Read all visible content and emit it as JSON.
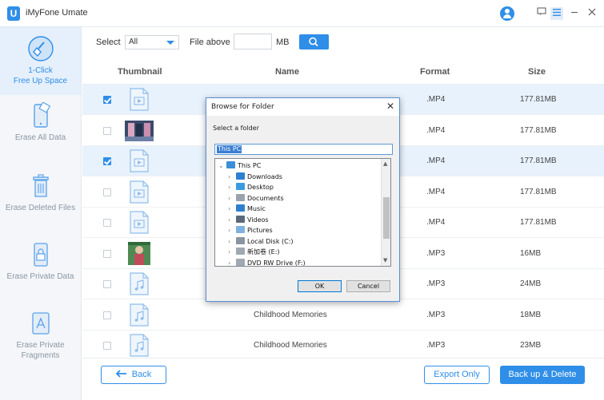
{
  "app": {
    "title": "iMyFone Umate",
    "logo_letter": "U"
  },
  "sidebar": {
    "items": [
      {
        "label": "1-Click\nFree Up Space",
        "line1": "1-Click",
        "line2": "Free Up Space",
        "icon": "broom-icon",
        "active": true
      },
      {
        "label": "Erase All Data",
        "icon": "phone-eraser-icon",
        "active": false
      },
      {
        "label": "Erase Deleted Files",
        "icon": "trash-icon",
        "active": false
      },
      {
        "label": "Erase Private Data",
        "icon": "lock-icon",
        "active": false
      },
      {
        "label": "Erase Private Fragments",
        "line1": "Erase Private",
        "line2": "Fragments",
        "icon": "app-fragment-icon",
        "active": false
      }
    ]
  },
  "filter": {
    "select_label": "Select",
    "select_value": "All",
    "file_above_label": "File above",
    "size_value": "",
    "unit": "MB"
  },
  "table": {
    "headers": {
      "thumbnail": "Thumbnail",
      "name": "Name",
      "format": "Format",
      "size": "Size"
    },
    "rows": [
      {
        "checked": true,
        "thumb": "video",
        "name": "",
        "format": ".MP4",
        "size": "177.81MB"
      },
      {
        "checked": false,
        "thumb": "photo",
        "name": "",
        "format": ".MP4",
        "size": "177.81MB"
      },
      {
        "checked": true,
        "thumb": "video",
        "name": "",
        "format": ".MP4",
        "size": "177.81MB"
      },
      {
        "checked": false,
        "thumb": "video",
        "name": "",
        "format": ".MP4",
        "size": "177.81MB"
      },
      {
        "checked": false,
        "thumb": "video",
        "name": "",
        "format": ".MP4",
        "size": "177.81MB"
      },
      {
        "checked": false,
        "thumb": "photo2",
        "name": "",
        "format": ".MP3",
        "size": "16MB"
      },
      {
        "checked": false,
        "thumb": "audio",
        "name": "",
        "format": ".MP3",
        "size": "24MB"
      },
      {
        "checked": false,
        "thumb": "audio",
        "name": "Childhood Memories",
        "format": ".MP3",
        "size": "18MB"
      },
      {
        "checked": false,
        "thumb": "audio",
        "name": "Childhood Memories",
        "format": ".MP3",
        "size": "23MB"
      }
    ]
  },
  "footer": {
    "back": "Back",
    "export": "Export Only",
    "delete": "Back up & Delete"
  },
  "dialog": {
    "title": "Browse for Folder",
    "subtitle": "Select a folder",
    "input_value": "This PC",
    "tree": [
      {
        "label": "This PC",
        "level": 0,
        "expanded": true,
        "icon": "monitor-icon"
      },
      {
        "label": "Downloads",
        "level": 1,
        "icon": "download-icon"
      },
      {
        "label": "Desktop",
        "level": 1,
        "icon": "desktop-icon"
      },
      {
        "label": "Documents",
        "level": 1,
        "icon": "documents-icon"
      },
      {
        "label": "Music",
        "level": 1,
        "icon": "music-icon"
      },
      {
        "label": "Videos",
        "level": 1,
        "icon": "videos-icon"
      },
      {
        "label": "Pictures",
        "level": 1,
        "icon": "pictures-icon"
      },
      {
        "label": "Local Disk (C:)",
        "level": 1,
        "icon": "disk-icon"
      },
      {
        "label": "新加卷 (E:)",
        "level": 1,
        "icon": "drive-icon"
      },
      {
        "label": "DVD RW Drive (F:)",
        "level": 1,
        "icon": "dvd-icon"
      }
    ],
    "ok": "OK",
    "cancel": "Cancel"
  },
  "colors": {
    "accent": "#2f8ee8",
    "sidebar_bg": "#f4f6f9",
    "selected_row": "#e8f2fd"
  }
}
